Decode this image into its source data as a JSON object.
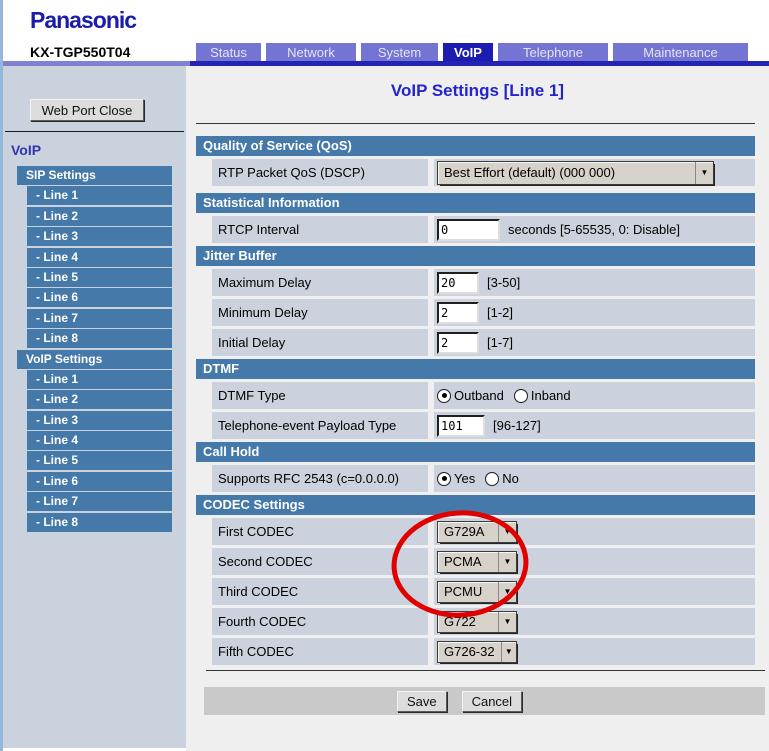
{
  "brand": {
    "logo": "Panasonic",
    "model": "KX-TGP550T04"
  },
  "tabs": [
    {
      "label": "Status",
      "active": false
    },
    {
      "label": "Network",
      "active": false
    },
    {
      "label": "System",
      "active": false
    },
    {
      "label": "VoIP",
      "active": true
    },
    {
      "label": "Telephone",
      "active": false
    },
    {
      "label": "Maintenance",
      "active": false
    }
  ],
  "sidebar": {
    "close_button": "Web Port Close",
    "heading": "VoIP",
    "groups": [
      {
        "label": "SIP Settings",
        "items": [
          "- Line 1",
          "- Line 2",
          "- Line 3",
          "- Line 4",
          "- Line 5",
          "- Line 6",
          "- Line 7",
          "- Line 8"
        ]
      },
      {
        "label": "VoIP Settings",
        "items": [
          "- Line 1",
          "- Line 2",
          "- Line 3",
          "- Line 4",
          "- Line 5",
          "- Line 6",
          "- Line 7",
          "- Line 8"
        ]
      }
    ]
  },
  "main": {
    "title": "VoIP Settings [Line 1]",
    "sections": {
      "qos": "Quality of Service (QoS)",
      "statistical": "Statistical Information",
      "jitter": "Jitter Buffer",
      "dtmf": "DTMF",
      "call_hold": "Call Hold",
      "codec": "CODEC Settings"
    },
    "fields": {
      "rtp_qos": {
        "label": "RTP Packet QoS (DSCP)",
        "value": "Best Effort (default) (000 000)"
      },
      "rtcp_interval": {
        "label": "RTCP Interval",
        "value": "0",
        "hint": "seconds [5-65535, 0: Disable]"
      },
      "max_delay": {
        "label": "Maximum Delay",
        "value": "20",
        "hint": "[3-50]"
      },
      "min_delay": {
        "label": "Minimum Delay",
        "value": "2",
        "hint": "[1-2]"
      },
      "initial_delay": {
        "label": "Initial Delay",
        "value": "2",
        "hint": "[1-7]"
      },
      "dtmf_type": {
        "label": "DTMF Type",
        "options": [
          "Outband",
          "Inband"
        ],
        "selected": "Outband"
      },
      "payload_type": {
        "label": "Telephone-event Payload Type",
        "value": "101",
        "hint": "[96-127]"
      },
      "rfc2543": {
        "label": "Supports RFC 2543 (c=0.0.0.0)",
        "options": [
          "Yes",
          "No"
        ],
        "selected": "Yes"
      },
      "codec1": {
        "label": "First CODEC",
        "value": "G729A"
      },
      "codec2": {
        "label": "Second CODEC",
        "value": "PCMA"
      },
      "codec3": {
        "label": "Third CODEC",
        "value": "PCMU"
      },
      "codec4": {
        "label": "Fourth CODEC",
        "value": "G722"
      },
      "codec5": {
        "label": "Fifth CODEC",
        "value": "G726-32"
      }
    },
    "annotation": {
      "shape": "ellipse",
      "color": "#e10000"
    }
  },
  "footer": {
    "save": "Save",
    "cancel": "Cancel"
  },
  "colors": {
    "tab_inactive": "#7474d2",
    "tab_active": "#1c1cb0",
    "section_blue": "#4579a9",
    "row_bg": "#cbd2dd",
    "sidebar_bg": "#c9d2dd",
    "main_bg": "#efefef",
    "title_blue": "#2424cc",
    "logo_blue": "#1c1cab",
    "annotation_red": "#e10000"
  }
}
